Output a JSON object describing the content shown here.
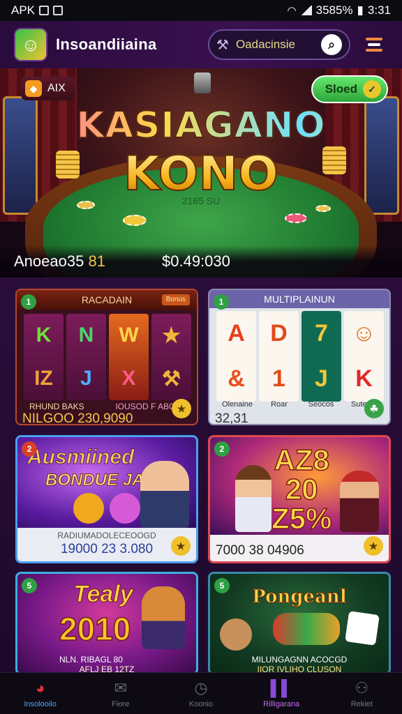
{
  "status_bar": {
    "carrier": "APK",
    "battery": "3585%",
    "time": "3:31"
  },
  "header": {
    "app_name": "Insoandiiaina",
    "search_text": "Oadacinsie"
  },
  "hero": {
    "badge_label": "AIX",
    "button_label": "Sloed",
    "title_line1": "KASIAGANO",
    "title_line2": "KONO",
    "felt_text": "2165 SU",
    "stat_label": "Anoeao35",
    "stat_value": "81",
    "balance": "$0.49:030"
  },
  "cards": [
    {
      "corner": "1",
      "banner": "RACADAIN",
      "tag": "Bonus",
      "reels": [
        [
          "K",
          "IZ"
        ],
        [
          "N",
          "J"
        ],
        [
          "W",
          "X"
        ],
        [
          "★",
          "⚒"
        ]
      ],
      "sub_left": "RHUND BAKS",
      "sub_right": "IOUSOD F ABOIO",
      "value": "NILGOO 230,9090"
    },
    {
      "corner": "1",
      "banner": "MULTIPLAINUN",
      "reels": [
        [
          "A",
          "&"
        ],
        [
          "D",
          "1"
        ],
        [
          "7",
          "J"
        ],
        [
          "☺",
          "K"
        ]
      ],
      "labels": [
        "Olenaine",
        "Roar",
        "Seocos",
        "Sutees"
      ],
      "value": "32,31"
    },
    {
      "corner": "2",
      "title1": "Ausmiined",
      "title2": "BONDUE JAN",
      "sub": "RADIUMADOLECEOOGD",
      "value": "19000 23 3.080"
    },
    {
      "corner": "2",
      "title_top": "AZ8",
      "title_mid": "20",
      "title_bot": "Z5%",
      "value": "7000 38 04906"
    },
    {
      "corner": "5",
      "title1": "Tealy",
      "title2": "2010",
      "sub": "NLN. RIBAGL 80",
      "sub2": "AFLJ EB 12TZ"
    },
    {
      "corner": "5",
      "title": "Pongeanl",
      "sub": "MILUNGAGNN ACOCGD",
      "sub2": "IIOR IVLIHO CLUSON"
    }
  ],
  "bottom_nav": [
    {
      "label": "Insolooilo",
      "icon": "home-icon"
    },
    {
      "label": "Fiore",
      "icon": "box-icon"
    },
    {
      "label": "Koonio",
      "icon": "clock-icon"
    },
    {
      "label": "Rilligarana",
      "icon": "books-icon"
    },
    {
      "label": "Rekiet",
      "icon": "profile-icon"
    }
  ],
  "colors": {
    "accent_gold": "#f6c84a",
    "nav_active": "#4aa8ff",
    "nav_highlight": "#c46cf0",
    "hero_button": "#2ea53a"
  }
}
